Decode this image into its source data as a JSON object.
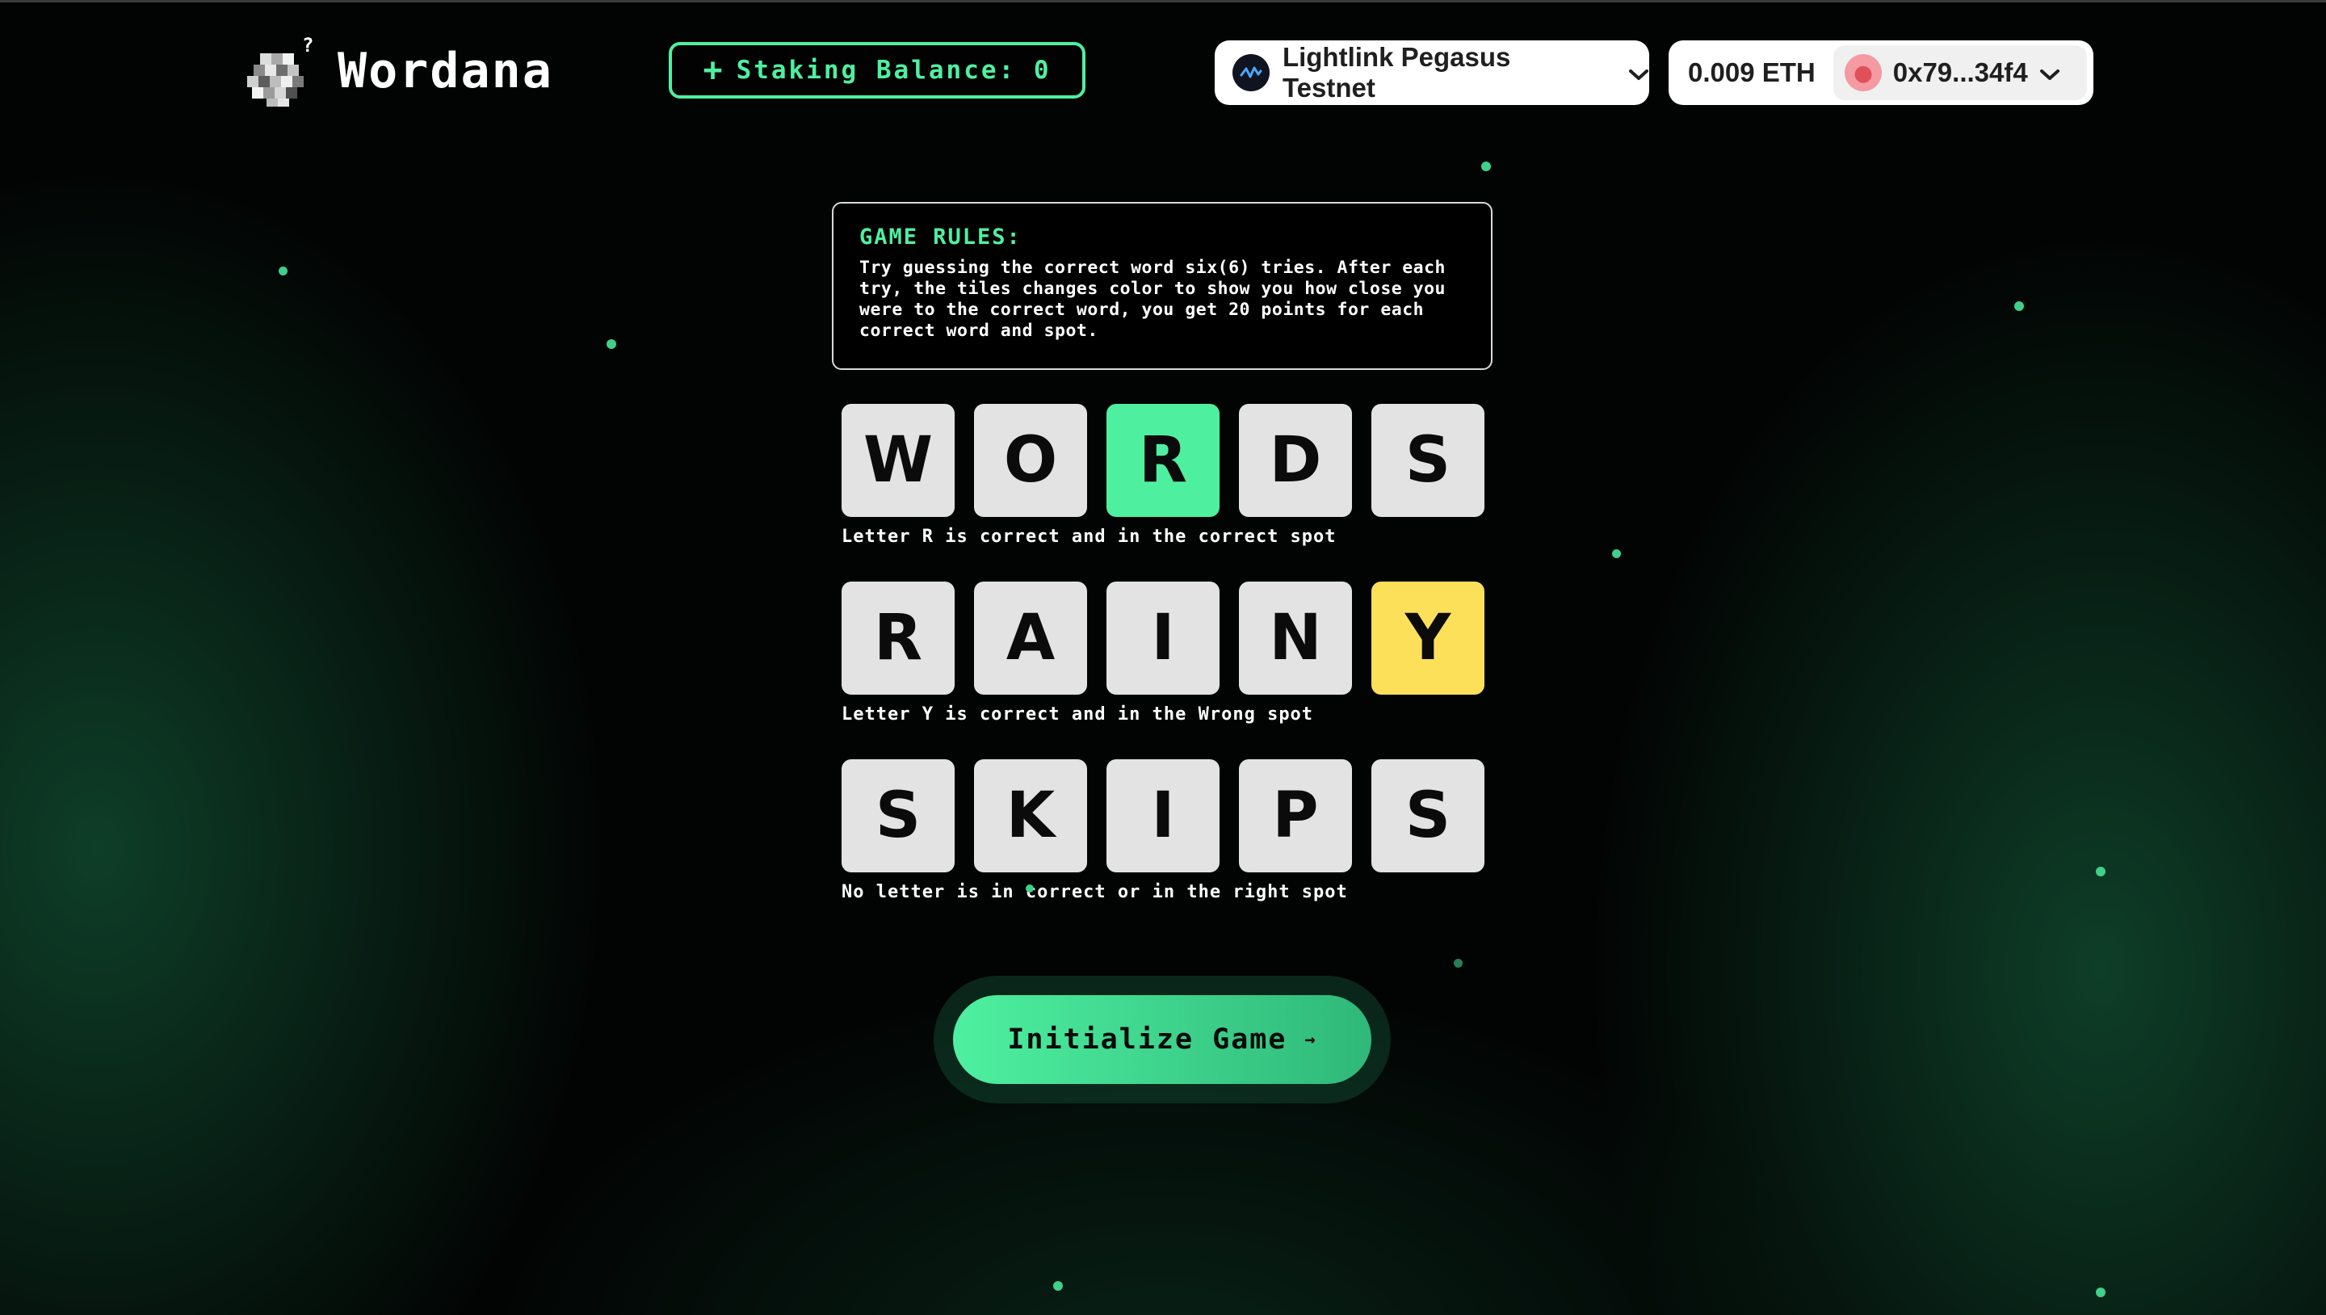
{
  "header": {
    "brand": "Wordana",
    "staking_plus": "+",
    "staking_label": "Staking Balance: 0",
    "network": "Lightlink Pegasus Testnet",
    "balance": "0.009 ETH",
    "address": "0x79...34f4"
  },
  "rules": {
    "title": "GAME RULES:",
    "body": "Try guessing the correct word six(6) tries. After each try, the tiles changes color to show you how close you were to the correct word, you get 20 points for each correct word and spot."
  },
  "examples": [
    {
      "letters": [
        "W",
        "O",
        "R",
        "D",
        "S"
      ],
      "states": [
        "absent",
        "absent",
        "correct",
        "absent",
        "absent"
      ],
      "caption": "Letter R is correct and in the correct spot"
    },
    {
      "letters": [
        "R",
        "A",
        "I",
        "N",
        "Y"
      ],
      "states": [
        "absent",
        "absent",
        "absent",
        "absent",
        "present"
      ],
      "caption": "Letter Y is correct and in the Wrong spot"
    },
    {
      "letters": [
        "S",
        "K",
        "I",
        "P",
        "S"
      ],
      "states": [
        "absent",
        "absent",
        "absent",
        "absent",
        "absent"
      ],
      "caption": "No letter is in correct or in the right spot"
    }
  ],
  "actions": {
    "init_label": "Initialize Game",
    "init_arrow": "→"
  },
  "colors": {
    "accent": "#4ef0a0",
    "present": "#fde05a",
    "tile": "#e3e3e3"
  },
  "icons": {
    "logo": "pixel-cube-question-icon",
    "network": "lightlink-network-icon",
    "chevron": "chevron-down-icon",
    "avatar": "account-avatar-icon"
  }
}
